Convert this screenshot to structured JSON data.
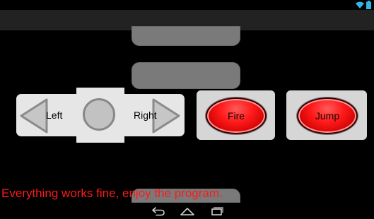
{
  "status_bar": {
    "icons": [
      "wifi-icon",
      "battery-icon"
    ],
    "accent_color": "#33b5e5"
  },
  "dpad": {
    "left_label": "Left",
    "right_label": "Right"
  },
  "buttons": {
    "fire_label": "Fire",
    "jump_label": "Jump",
    "color": "#ff1a1a"
  },
  "status_message": {
    "text": "Everything works fine, enjoy the program.",
    "color": "#ff1a1a"
  },
  "nav_bar": {
    "items": [
      "back-icon",
      "home-icon",
      "recent-apps-icon"
    ]
  }
}
